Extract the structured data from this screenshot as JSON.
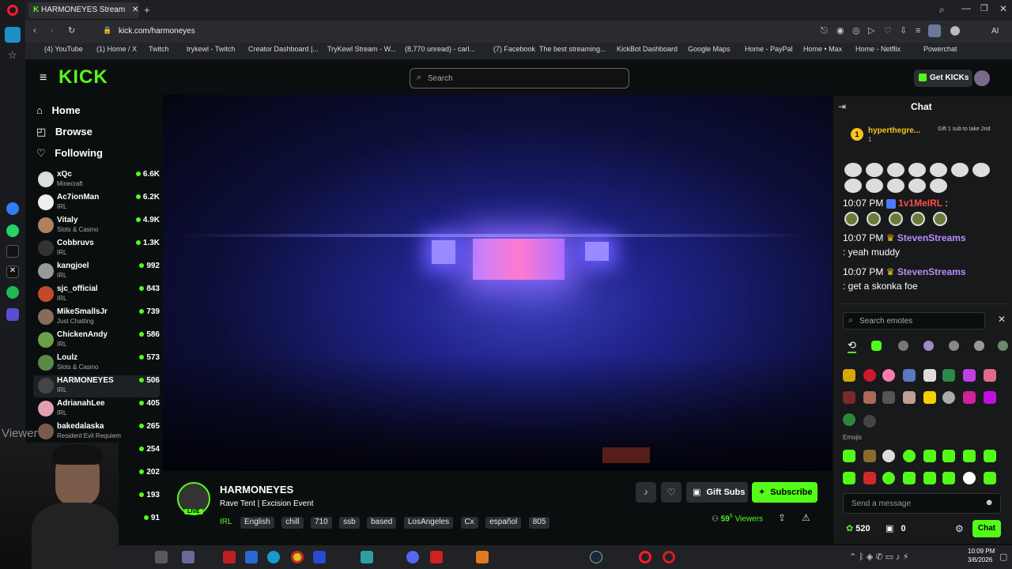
{
  "browser": {
    "tab_title": "HARMONEYES Stream",
    "url": "kick.com/harmoneyes",
    "bookmarks": [
      "(4) YouTube",
      "(1) Home / X",
      "Twitch",
      "trykewl - Twitch",
      "Creator Dashboard |...",
      "TryKewl Stream - W...",
      "(8,770 unread) - carl...",
      "(7) Facebook",
      "The best streaming...",
      "KickBot Dashboard",
      "Google Maps",
      "Home - PayPal",
      "Home • Max",
      "Home - Netflix",
      "Powerchat"
    ],
    "ai_label": "AI"
  },
  "header": {
    "logo": "KICK",
    "search_placeholder": "Search",
    "get_kicks": "Get KICKs"
  },
  "nav": {
    "home": "Home",
    "browse": "Browse",
    "following": "Following"
  },
  "channels": [
    {
      "name": "xQc",
      "category": "Minecraft",
      "viewers": "6.6K"
    },
    {
      "name": "Ac7ionMan",
      "category": "IRL",
      "viewers": "6.2K"
    },
    {
      "name": "Vitaly",
      "category": "Slots & Casino",
      "viewers": "4.9K"
    },
    {
      "name": "Cobbruvs",
      "category": "IRL",
      "viewers": "1.3K"
    },
    {
      "name": "kangjoel",
      "category": "IRL",
      "viewers": "992"
    },
    {
      "name": "sjc_official",
      "category": "IRL",
      "viewers": "843"
    },
    {
      "name": "MikeSmallsJr",
      "category": "Just Chatting",
      "viewers": "739"
    },
    {
      "name": "ChickenAndy",
      "category": "IRL",
      "viewers": "586"
    },
    {
      "name": "Loulz",
      "category": "Slots & Casino",
      "viewers": "573"
    },
    {
      "name": "HARMONEYES",
      "category": "IRL",
      "viewers": "506"
    },
    {
      "name": "AdrianahLee",
      "category": "IRL",
      "viewers": "405"
    },
    {
      "name": "bakedalaska",
      "category": "Resident Evil Requiem",
      "viewers": "265"
    },
    {
      "name": "",
      "category": "",
      "viewers": "254"
    },
    {
      "name": "",
      "category": "",
      "viewers": "202"
    },
    {
      "name": "",
      "category": "",
      "viewers": "193"
    },
    {
      "name": "",
      "category": "",
      "viewers": "91"
    }
  ],
  "overlay_text": "Viewer",
  "stream": {
    "channel": "HARMONEYES",
    "live_badge": "LIVE",
    "title": "Rave Tent | Excision Event",
    "tags": [
      "IRL",
      "English",
      "chill",
      "710",
      "ssb",
      "based",
      "LosAngeles",
      "Cx",
      "español",
      "805"
    ],
    "gift_subs": "Gift Subs",
    "subscribe": "Subscribe",
    "viewers_count": "59",
    "viewers_sup": "5",
    "viewers_label": "Viewers"
  },
  "chat": {
    "title": "Chat",
    "pinned_user": "hyperthegre...",
    "pinned_sub": "1",
    "gift_text": "Gift 1 sub to take 2nd",
    "messages": [
      {
        "time": "10:07 PM",
        "user": "1v1MeIRL",
        "text": ":"
      },
      {
        "time": "10:07 PM",
        "user": "StevenStreams",
        "text": ": yeah muddy"
      },
      {
        "time": "10:07 PM",
        "user": "StevenStreams",
        "text": ": get a skonka foe"
      }
    ],
    "emote_search_placeholder": "Search emotes",
    "emojis_label": "Emojis",
    "message_placeholder": "Send a message",
    "kicks_count": "520",
    "gift_count": "0",
    "send_button": "Chat"
  },
  "taskbar": {
    "time": "10:09 PM",
    "date": "3/6/2026"
  },
  "colors": {
    "kick_green": "#53fc18",
    "background": "#0b0e0f",
    "chat_bg": "#18191b",
    "steven_purple": "#b98cff",
    "red_user": "#ff4d4d"
  }
}
